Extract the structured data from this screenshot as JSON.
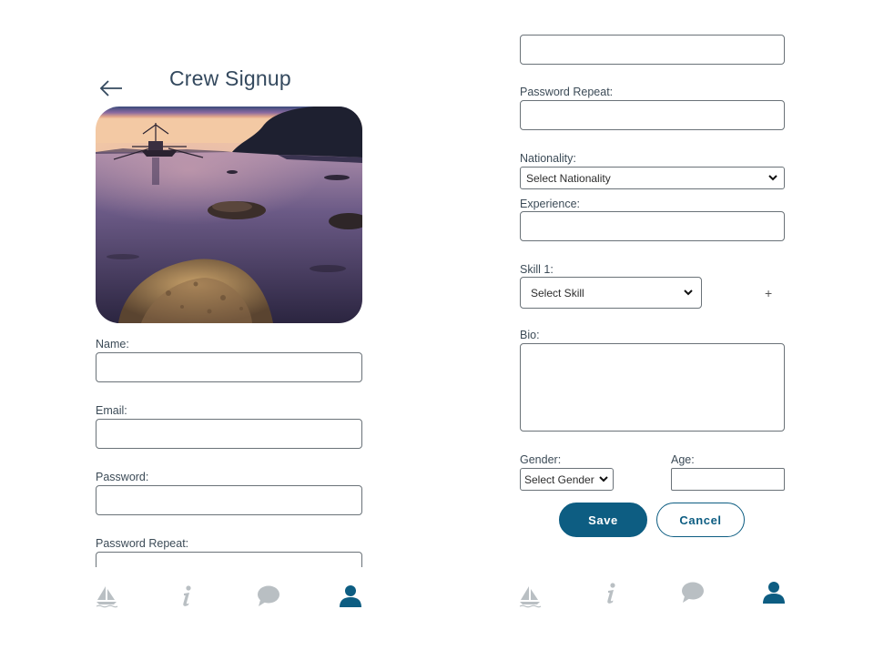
{
  "colors": {
    "accent": "#0d5d82",
    "nav_inactive": "#b9bfc3",
    "nav_active": "#0d5d82"
  },
  "left": {
    "title": "Crew Signup",
    "back_icon": "arrow-left-icon",
    "fields": {
      "name_label": "Name:",
      "email_label": "Email:",
      "password_label": "Password:",
      "password_repeat_label": "Password Repeat:"
    }
  },
  "right": {
    "password_repeat_label": "Password Repeat:",
    "nationality_label": "Nationality:",
    "nationality_value": "Select Nationality",
    "experience_label": "Experience:",
    "skill_label": "Skill 1:",
    "skill_value": "Select Skill",
    "add_skill": "+",
    "bio_label": "Bio:",
    "gender_label": "Gender:",
    "gender_value": "Select Gender",
    "age_label": "Age:",
    "save_label": "Save",
    "cancel_label": "Cancel"
  },
  "nav": [
    {
      "icon": "sailboat-icon",
      "active": false
    },
    {
      "icon": "info-icon",
      "active": false
    },
    {
      "icon": "chat-bubble-icon",
      "active": false
    },
    {
      "icon": "user-icon",
      "active": true
    }
  ]
}
